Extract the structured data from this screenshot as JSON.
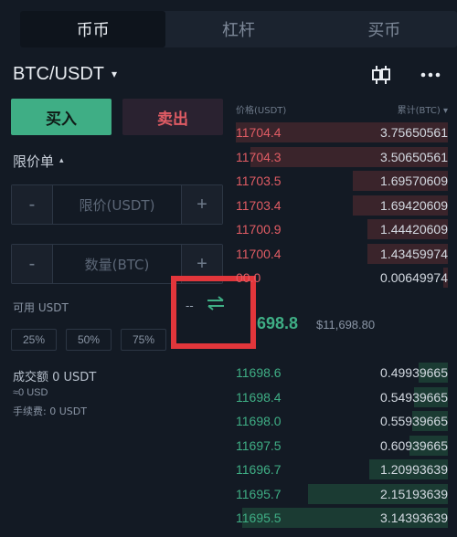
{
  "tabs": [
    {
      "label": "币币",
      "active": true
    },
    {
      "label": "杠杆",
      "active": false
    },
    {
      "label": "买币",
      "active": false
    }
  ],
  "pair": {
    "label": "BTC/USDT",
    "caret": "▾"
  },
  "icons": {
    "kline": "candlestick-icon",
    "more": "more-icon"
  },
  "actions": {
    "buy": "买入",
    "sell": "卖出"
  },
  "order_type": {
    "label": "限价单",
    "caret": "▴"
  },
  "price_input": {
    "minus": "-",
    "placeholder": "限价(USDT)",
    "plus": "+"
  },
  "amount_input": {
    "minus": "-",
    "placeholder": "数量(BTC)",
    "plus": "+"
  },
  "available": {
    "label": "可用 USDT",
    "value": "--"
  },
  "percent_buttons": [
    "25%",
    "50%",
    "75%"
  ],
  "summary": {
    "total": "成交额 0 USDT",
    "approx": "≈0 USD",
    "fee": "手续费: 0 USDT"
  },
  "orderbook": {
    "price_header": "价格(USDT)",
    "total_header": "累计(BTC) ▾",
    "asks": [
      {
        "price": "11704.4",
        "qty": "3.75650561",
        "depth": 1.0
      },
      {
        "price": "11704.3",
        "qty": "3.50650561",
        "depth": 0.93
      },
      {
        "price": "11703.5",
        "qty": "1.69570609",
        "depth": 0.45
      },
      {
        "price": "11703.4",
        "qty": "1.69420609",
        "depth": 0.45
      },
      {
        "price": "11700.9",
        "qty": "1.44420609",
        "depth": 0.38
      },
      {
        "price": "11700.4",
        "qty": "1.43459974",
        "depth": 0.38
      },
      {
        "price": "00.0",
        "qty": "0.00649974",
        "depth": 0.02
      }
    ],
    "mid": {
      "price": "698.8",
      "fiat": "$11,698.80"
    },
    "bids": [
      {
        "price": "11698.6",
        "qty": "0.49939665",
        "depth": 0.14
      },
      {
        "price": "11698.4",
        "qty": "0.54939665",
        "depth": 0.16
      },
      {
        "price": "11698.0",
        "qty": "0.55939665",
        "depth": 0.17
      },
      {
        "price": "11697.5",
        "qty": "0.60939665",
        "depth": 0.18
      },
      {
        "price": "11696.7",
        "qty": "1.20993639",
        "depth": 0.37
      },
      {
        "price": "11695.7",
        "qty": "2.15193639",
        "depth": 0.66
      },
      {
        "price": "11695.5",
        "qty": "3.14393639",
        "depth": 0.97
      }
    ]
  },
  "colors": {
    "buy": "#3fae85",
    "sell": "#e05c64",
    "highlight": "#e2363b"
  }
}
